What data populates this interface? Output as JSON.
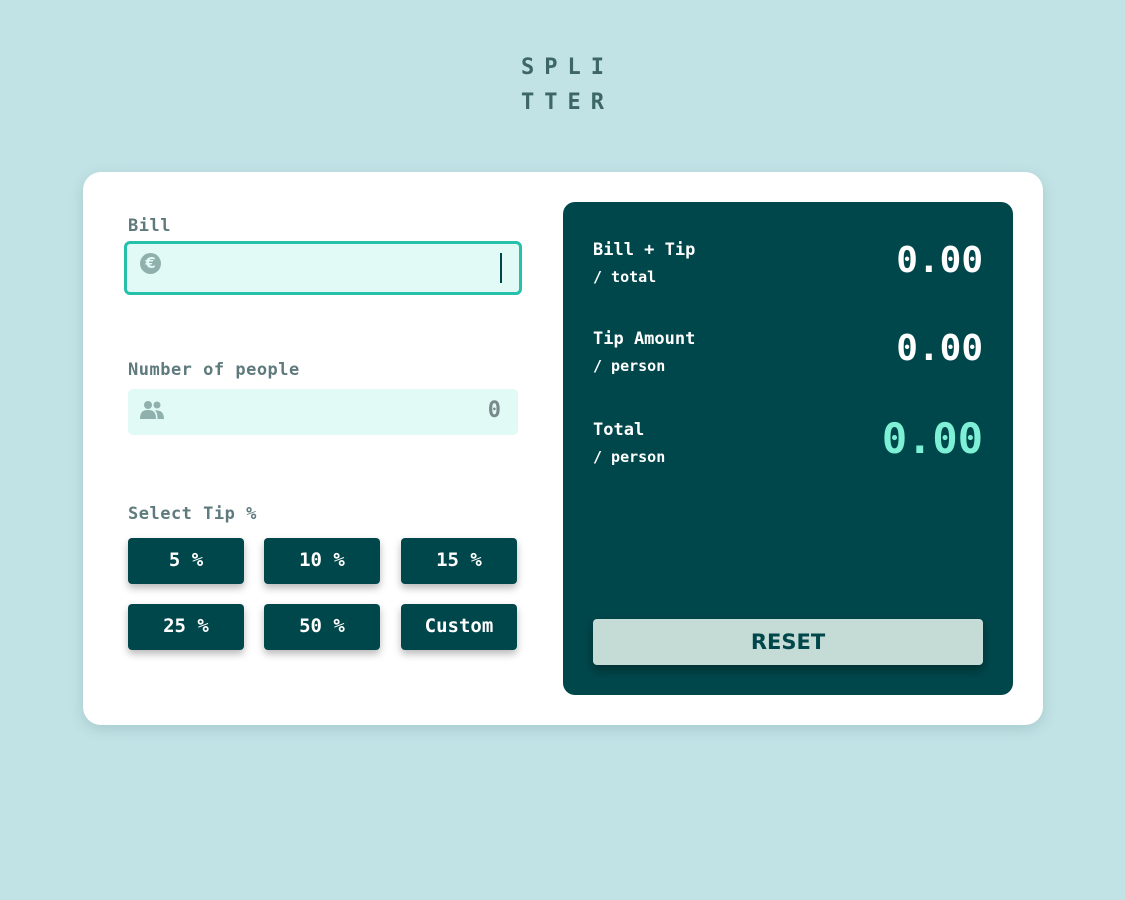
{
  "logo": {
    "line1": "SPLI",
    "line2": "TTER"
  },
  "bill": {
    "label": "Bill",
    "icon": "euro-icon",
    "value": ""
  },
  "people": {
    "label": "Number of people",
    "icon": "people-icon",
    "value": "0"
  },
  "tip": {
    "label": "Select Tip %",
    "buttons": [
      "5 %",
      "10 %",
      "15 %",
      "25 %",
      "50 %",
      "Custom"
    ]
  },
  "results": {
    "bill_tip": {
      "label": "Bill + Tip",
      "sub": "/ total",
      "value": "0.00"
    },
    "tip_amount": {
      "label": "Tip Amount",
      "sub": "/ person",
      "value": "0.00"
    },
    "total": {
      "label": "Total",
      "sub": "/ person",
      "value": "0.00"
    }
  },
  "reset_label": "RESET",
  "colors": {
    "background": "#c2e3e6",
    "panel": "#00474b",
    "accent": "#7ef0d6",
    "input_bg": "#e2faf5",
    "focus_border": "#26c0ab",
    "reset_bg": "#c5dbd6"
  }
}
